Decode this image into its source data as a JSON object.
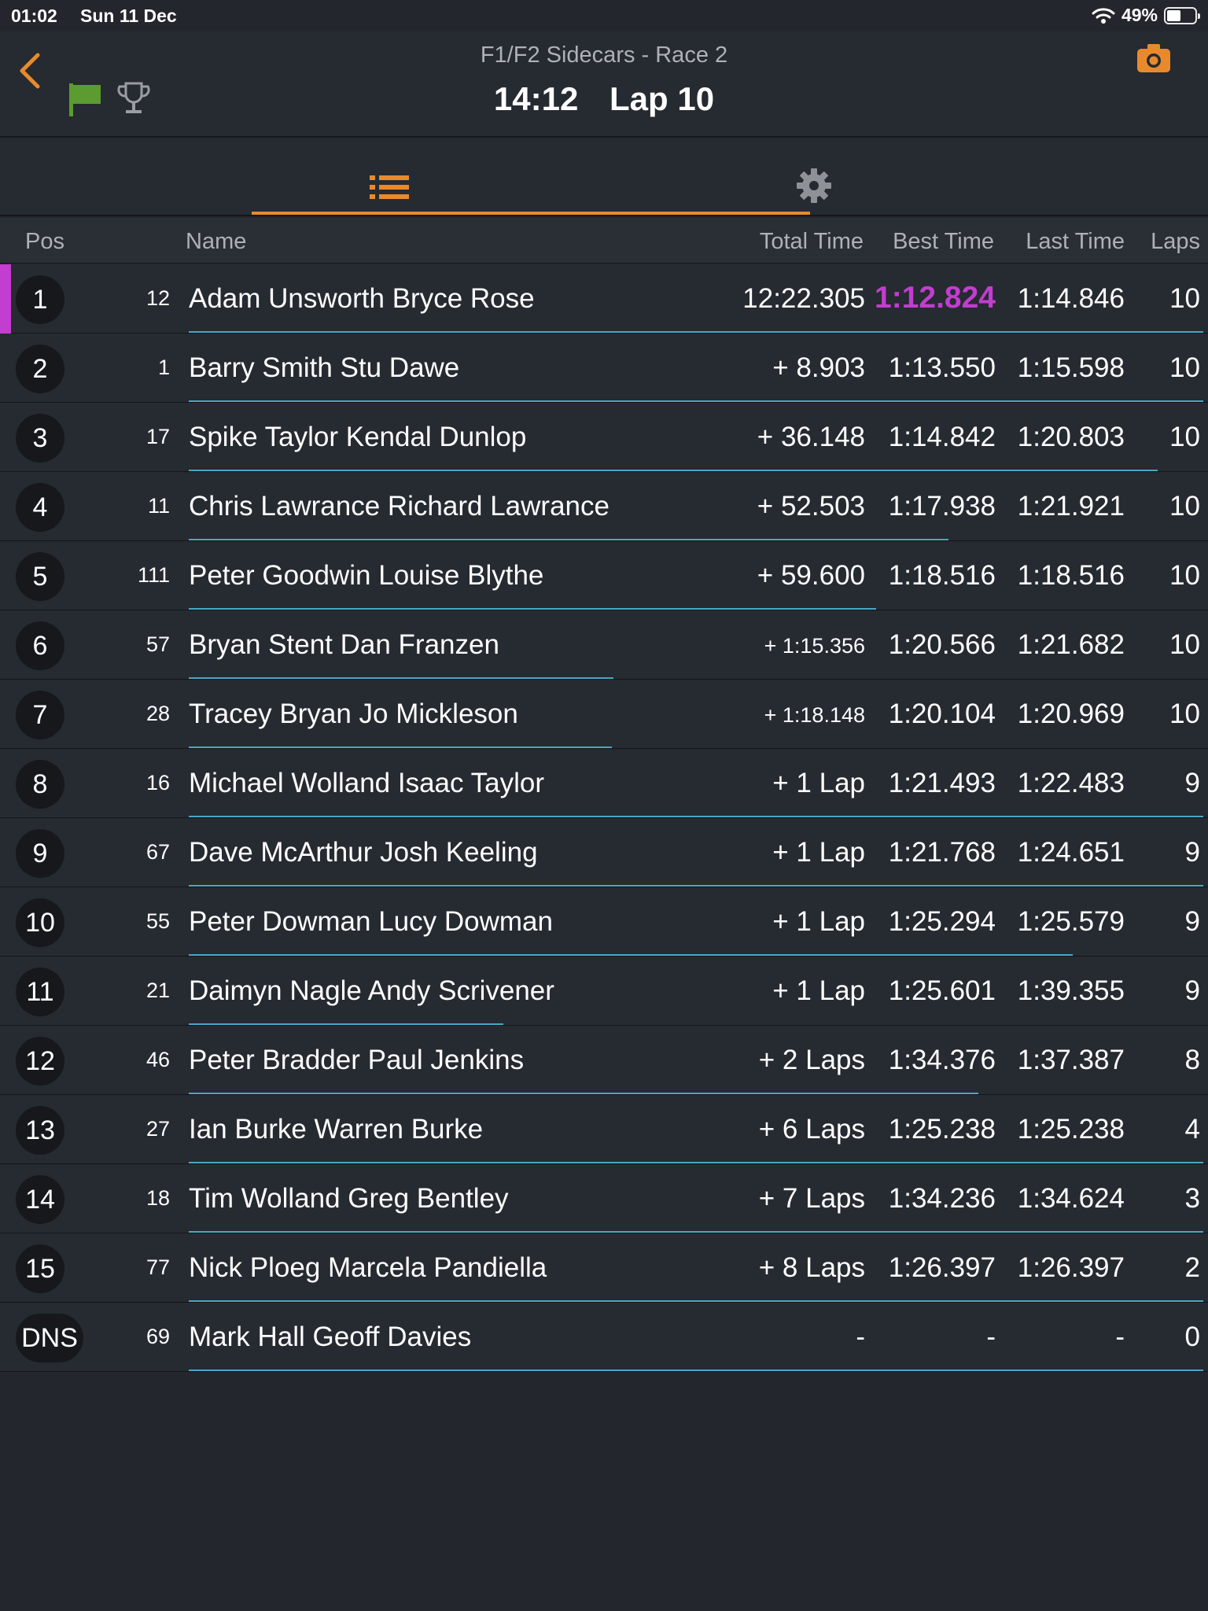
{
  "status_bar": {
    "time": "01:02",
    "date": "Sun 11 Dec",
    "battery": "49%",
    "battery_level": 0.49
  },
  "header": {
    "title": "F1/F2 Sidecars - Race 2",
    "clock": "14:12",
    "lap": "Lap 10"
  },
  "colors": {
    "accent": "#e88a2c",
    "fastest": "#c23dd0",
    "flag": "#5b9b2f",
    "gap_line": "#4aa7c4"
  },
  "icons": {
    "back": "chevron-left-icon",
    "flag": "green-flag-icon",
    "trophy": "trophy-icon",
    "camera": "camera-icon",
    "list": "list-icon",
    "settings": "gear-icon"
  },
  "table": {
    "columns": {
      "pos": "Pos",
      "name": "Name",
      "total": "Total Time",
      "best": "Best Time",
      "last": "Last Time",
      "laps": "Laps"
    },
    "rows": [
      {
        "pos": "1",
        "num": "12",
        "name": "Adam Unsworth Bryce Rose",
        "total": "12:22.305",
        "best": "1:12.824",
        "last": "1:14.846",
        "laps": "10",
        "fastest": true
      },
      {
        "pos": "2",
        "num": "1",
        "name": "Barry Smith Stu Dawe",
        "total": "+ 8.903",
        "best": "1:13.550",
        "last": "1:15.598",
        "laps": "10"
      },
      {
        "pos": "3",
        "num": "17",
        "name": "Spike Taylor Kendal Dunlop",
        "total": "+ 36.148",
        "best": "1:14.842",
        "last": "1:20.803",
        "laps": "10"
      },
      {
        "pos": "4",
        "num": "11",
        "name": "Chris Lawrance Richard Lawrance",
        "total": "+ 52.503",
        "best": "1:17.938",
        "last": "1:21.921",
        "laps": "10"
      },
      {
        "pos": "5",
        "num": "111",
        "name": "Peter Goodwin Louise Blythe",
        "total": "+ 59.600",
        "best": "1:18.516",
        "last": "1:18.516",
        "laps": "10"
      },
      {
        "pos": "6",
        "num": "57",
        "name": "Bryan Stent Dan Franzen",
        "total": "+ 1:15.356",
        "best": "1:20.566",
        "last": "1:21.682",
        "laps": "10",
        "small": true
      },
      {
        "pos": "7",
        "num": "28",
        "name": "Tracey Bryan Jo Mickleson",
        "total": "+ 1:18.148",
        "best": "1:20.104",
        "last": "1:20.969",
        "laps": "10",
        "small": true
      },
      {
        "pos": "8",
        "num": "16",
        "name": "Michael Wolland Isaac Taylor",
        "total": "+ 1 Lap",
        "best": "1:21.493",
        "last": "1:22.483",
        "laps": "9"
      },
      {
        "pos": "9",
        "num": "67",
        "name": "Dave McArthur Josh Keeling",
        "total": "+ 1 Lap",
        "best": "1:21.768",
        "last": "1:24.651",
        "laps": "9"
      },
      {
        "pos": "10",
        "num": "55",
        "name": "Peter Dowman Lucy Dowman",
        "total": "+ 1 Lap",
        "best": "1:25.294",
        "last": "1:25.579",
        "laps": "9"
      },
      {
        "pos": "11",
        "num": "21",
        "name": "Daimyn Nagle Andy Scrivener",
        "total": "+ 1 Lap",
        "best": "1:25.601",
        "last": "1:39.355",
        "laps": "9"
      },
      {
        "pos": "12",
        "num": "46",
        "name": "Peter Bradder Paul Jenkins",
        "total": "+ 2 Laps",
        "best": "1:34.376",
        "last": "1:37.387",
        "laps": "8"
      },
      {
        "pos": "13",
        "num": "27",
        "name": "Ian Burke Warren Burke",
        "total": "+ 6 Laps",
        "best": "1:25.238",
        "last": "1:25.238",
        "laps": "4"
      },
      {
        "pos": "14",
        "num": "18",
        "name": "Tim Wolland Greg Bentley",
        "total": "+ 7 Laps",
        "best": "1:34.236",
        "last": "1:34.624",
        "laps": "3"
      },
      {
        "pos": "15",
        "num": "77",
        "name": "Nick Ploeg Marcela Pandiella",
        "total": "+ 8 Laps",
        "best": "1:26.397",
        "last": "1:26.397",
        "laps": "2"
      },
      {
        "pos": "DNS",
        "num": "69",
        "name": "Mark Hall Geoff Davies",
        "total": "-",
        "best": "-",
        "last": "-",
        "laps": "0"
      }
    ]
  }
}
